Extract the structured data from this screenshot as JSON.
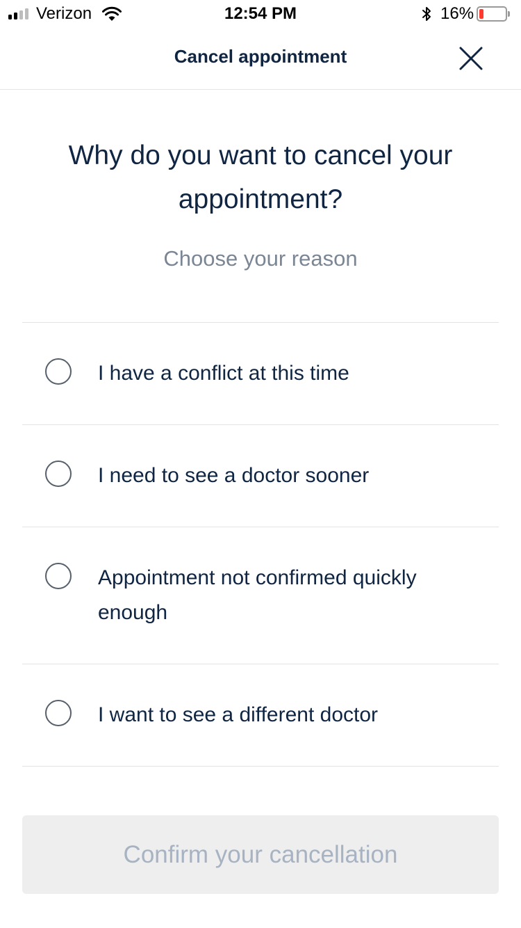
{
  "status_bar": {
    "carrier": "Verizon",
    "time": "12:54 PM",
    "battery_percent": "16%",
    "battery_level": 0.16,
    "battery_color": "#ff3b30",
    "signal_bars_filled": 2,
    "signal_bars_total": 4,
    "icons": [
      "wifi-icon",
      "bluetooth-icon",
      "battery-icon"
    ]
  },
  "navbar": {
    "title": "Cancel appointment",
    "close_icon": "close-icon"
  },
  "main": {
    "question": "Why do you want to cancel your appointment?",
    "subtitle": "Choose your reason",
    "reasons": [
      {
        "label": "I have a conflict at this time",
        "selected": false
      },
      {
        "label": "I need to see a doctor sooner",
        "selected": false
      },
      {
        "label": "Appointment not confirmed quickly enough",
        "selected": false
      },
      {
        "label": "I want to see a different doctor",
        "selected": false
      }
    ],
    "confirm_label": "Confirm your cancellation",
    "confirm_enabled": false
  },
  "colors": {
    "text_primary": "#0f2542",
    "text_secondary": "#7b8694",
    "divider": "#e3e3e3",
    "button_disabled_bg": "#eeeeee",
    "button_disabled_text": "#a7b3c2"
  }
}
